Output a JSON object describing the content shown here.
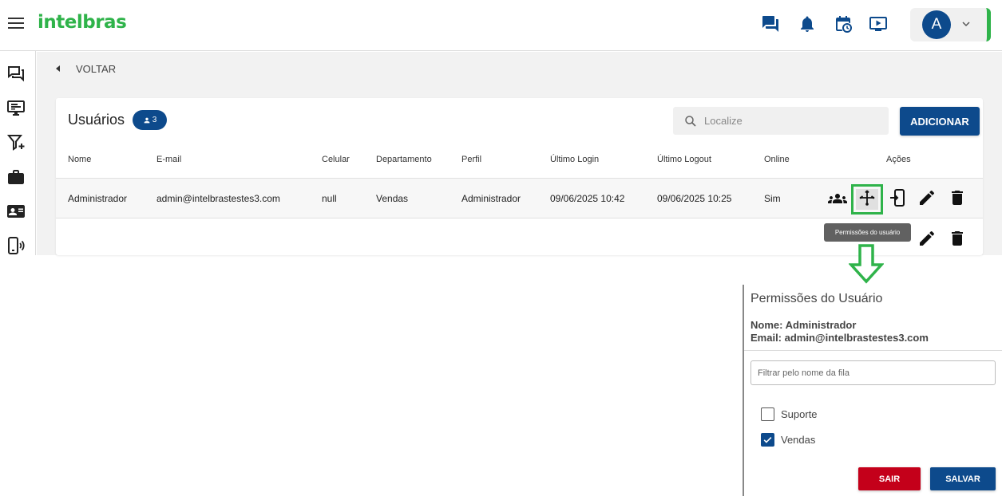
{
  "app": {
    "logo_text": "intelbras",
    "brand_color": "#2fb34a",
    "primary_color": "#0d4a8c",
    "danger_color": "#c4001a"
  },
  "topbar": {
    "icons": [
      "chat-icon",
      "bell-icon",
      "calendar-clock-icon",
      "play-screen-icon"
    ],
    "user": {
      "avatar_letter": "A"
    }
  },
  "sidebar": {
    "icons": [
      "chat-icon",
      "monitor-icon",
      "filter-add-icon",
      "briefcase-icon",
      "contact-card-icon",
      "phone-signal-icon"
    ]
  },
  "nav": {
    "back_label": "VOLTAR"
  },
  "users_card": {
    "title": "Usuários",
    "count": "3",
    "search_placeholder": "Localize",
    "add_label": "ADICIONAR",
    "columns": [
      "Nome",
      "E-mail",
      "Celular",
      "Departamento",
      "Perfil",
      "Último Login",
      "Último Logout",
      "Online",
      "Ações"
    ],
    "rows": [
      {
        "nome": "Administrador",
        "email": "admin@intelbrastestes3.com",
        "celular": "null",
        "departamento": "Vendas",
        "perfil": "Administrador",
        "ultimo_login": "09/06/2025 10:42",
        "ultimo_logout": "09/06/2025 10:25",
        "online": "Sim"
      }
    ],
    "action_icons": [
      "users-icon",
      "permissions-icon",
      "login-icon",
      "edit-icon",
      "delete-icon"
    ],
    "tooltip": "Permissões do usuário"
  },
  "permissions_dialog": {
    "title": "Permissões do Usuário",
    "name_line": "Nome: Administrador",
    "email_line": "Email: admin@intelbrastestes3.com",
    "filter_placeholder": "Filtrar pelo nome da fila",
    "options": [
      {
        "label": "Suporte",
        "checked": false
      },
      {
        "label": "Vendas",
        "checked": true
      }
    ],
    "cancel_label": "SAIR",
    "save_label": "SALVAR"
  }
}
